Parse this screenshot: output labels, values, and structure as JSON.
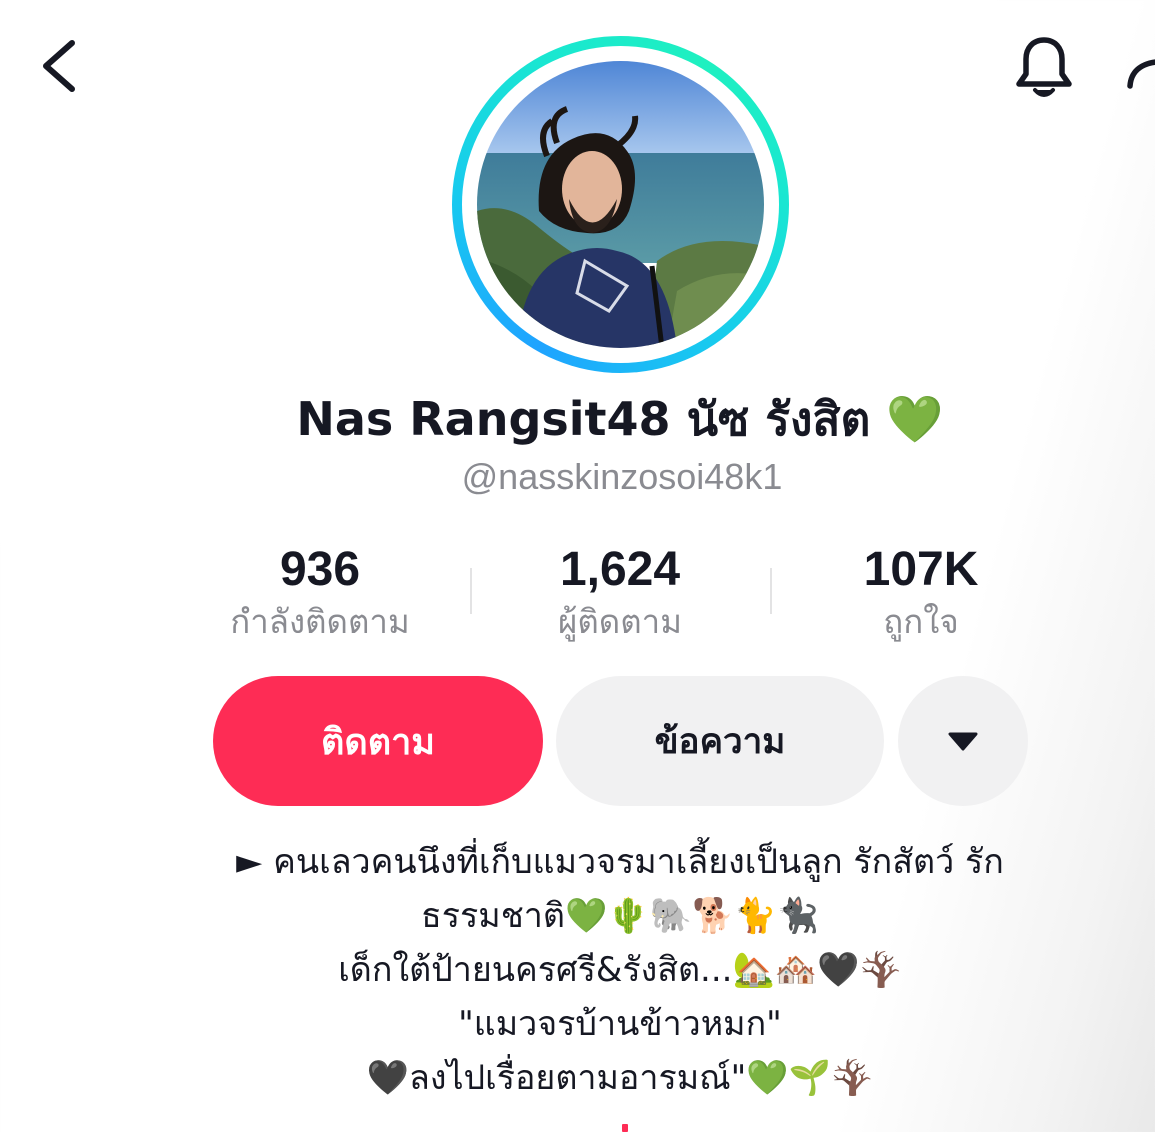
{
  "header": {
    "back_icon": "chevron-left-icon",
    "bell_icon": "bell-icon",
    "share_icon": "share-icon"
  },
  "profile": {
    "display_name": "Nas Rangsit48 นัซ รังสิต 💚",
    "username": "@nasskinzosoi48k1"
  },
  "stats": [
    {
      "value": "936",
      "label": "กำลังติดตาม"
    },
    {
      "value": "1,624",
      "label": "ผู้ติดตาม"
    },
    {
      "value": "107K",
      "label": "ถูกใจ"
    }
  ],
  "actions": {
    "follow_label": "ติดตาม",
    "message_label": "ข้อความ",
    "more_icon": "caret-down-icon"
  },
  "bio": {
    "lines": [
      "► คนเลวคนนึงที่เก็บแมวจรมาเลี้ยงเป็นลูก รักสัตว์ รัก",
      "ธรรมชาติ💚🌵🐘🐕🐈🐈‍⬛",
      "เด็กใต้ป้ายนครศรี&รังสิต...🏡🏘️🖤🪾",
      "\"แมวจรบ้านข้าวหมก\"",
      "🖤ลงไปเรื่อยตามอารมณ์\"💚🌱🪾"
    ]
  },
  "colors": {
    "follow_button": "#fe2c55",
    "secondary_button": "#f1f1f2",
    "text_primary": "#161823",
    "text_secondary": "#8a8b91",
    "ring_start": "#1fa3ff",
    "ring_end": "#1ef0c0"
  }
}
